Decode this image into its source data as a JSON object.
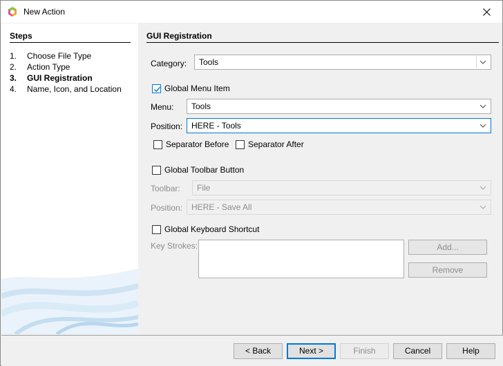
{
  "window": {
    "title": "New Action"
  },
  "steps": {
    "title": "Steps",
    "items": [
      {
        "num": "1.",
        "label": "Choose File Type"
      },
      {
        "num": "2.",
        "label": "Action Type"
      },
      {
        "num": "3.",
        "label": "GUI Registration"
      },
      {
        "num": "4.",
        "label": "Name, Icon, and Location"
      }
    ],
    "current_index": 2
  },
  "panel": {
    "title": "GUI Registration",
    "category": {
      "label": "Category:",
      "value": "Tools"
    },
    "global_menu_item": {
      "label": "Global Menu Item",
      "checked": true
    },
    "menu": {
      "label": "Menu:",
      "value": "Tools"
    },
    "position": {
      "label": "Position:",
      "value": "HERE - Tools"
    },
    "separator_before": {
      "label": "Separator Before",
      "checked": false
    },
    "separator_after": {
      "label": "Separator After",
      "checked": false
    },
    "global_toolbar_button": {
      "label": "Global Toolbar Button",
      "checked": false
    },
    "toolbar": {
      "label": "Toolbar:",
      "value": "File"
    },
    "toolbar_position": {
      "label": "Position:",
      "value": "HERE - Save All"
    },
    "global_keyboard_shortcut": {
      "label": "Global Keyboard Shortcut",
      "checked": false
    },
    "key_strokes": {
      "label": "Key Strokes:"
    },
    "add_button": "Add...",
    "remove_button": "Remove"
  },
  "footer": {
    "back": "< Back",
    "next": "Next >",
    "finish": "Finish",
    "cancel": "Cancel",
    "help": "Help"
  },
  "colors": {
    "accent": "#0078d7",
    "disabled_text": "#8c8c8c"
  }
}
